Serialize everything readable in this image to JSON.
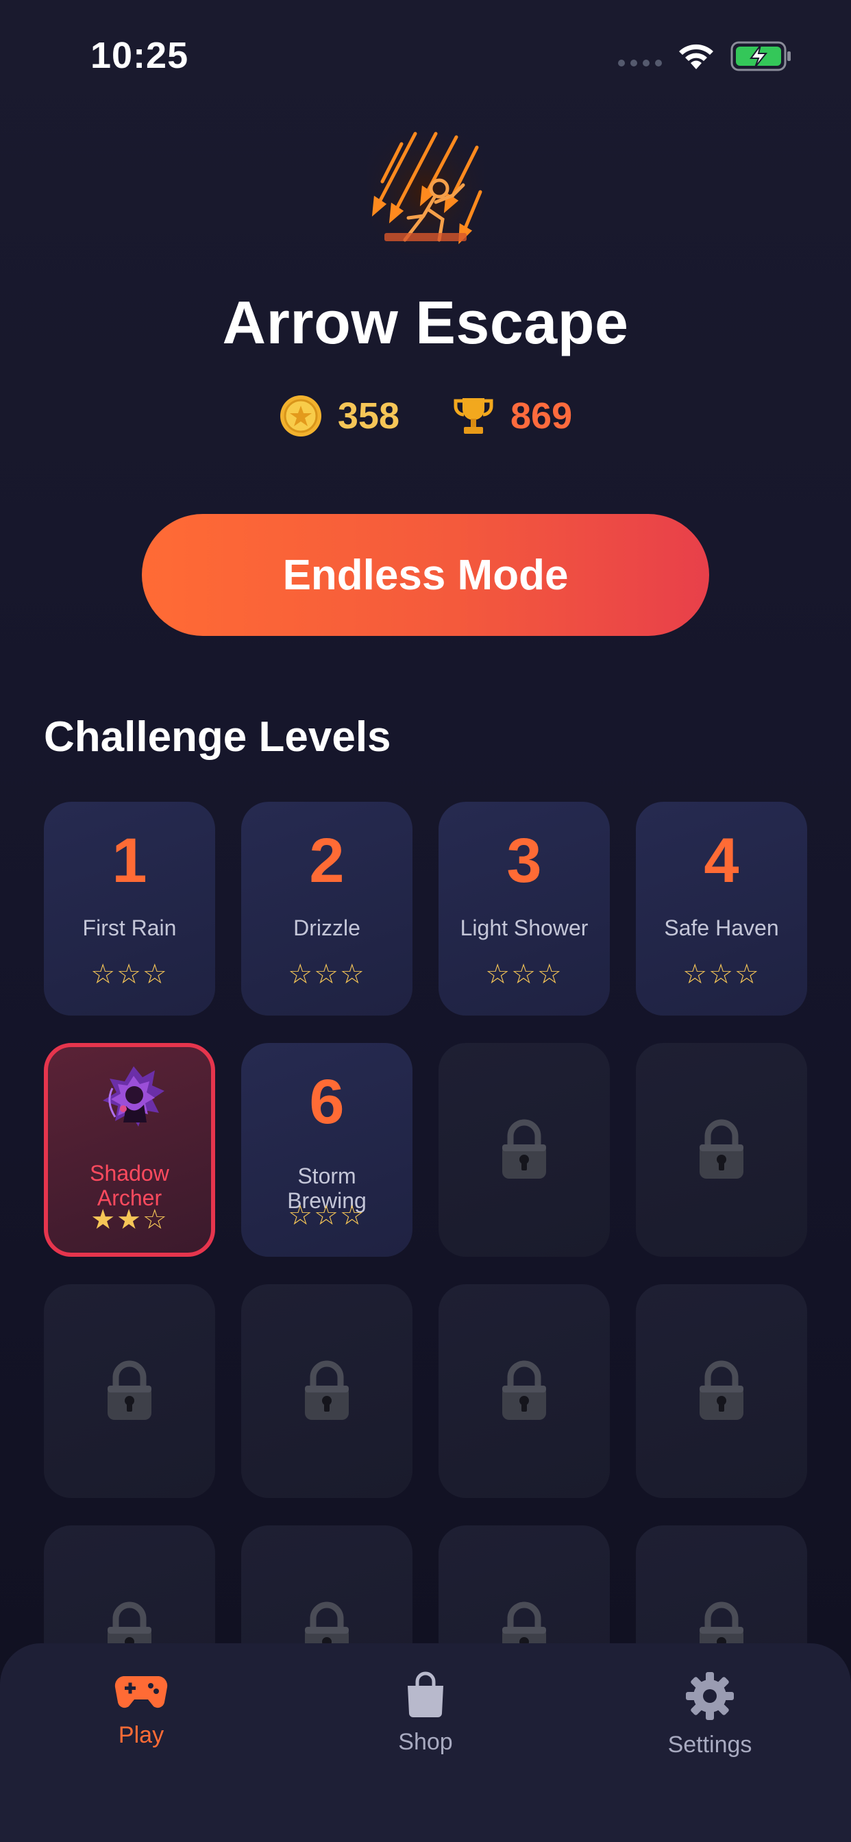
{
  "status_bar": {
    "time": "10:25"
  },
  "header": {
    "title": "Arrow Escape",
    "coins": "358",
    "trophies": "869"
  },
  "endless_button": {
    "label": "Endless Mode"
  },
  "section": {
    "title": "Challenge Levels"
  },
  "levels": [
    {
      "number": "1",
      "name": "First Rain",
      "stars": "☆☆☆",
      "earned": 0,
      "state": "unlocked"
    },
    {
      "number": "2",
      "name": "Drizzle",
      "stars": "☆☆☆",
      "earned": 0,
      "state": "unlocked"
    },
    {
      "number": "3",
      "name": "Light Shower",
      "stars": "☆☆☆",
      "earned": 0,
      "state": "unlocked"
    },
    {
      "number": "4",
      "name": "Safe Haven",
      "stars": "☆☆☆",
      "earned": 0,
      "state": "unlocked"
    },
    {
      "name_line1": "Shadow",
      "name_line2": "Archer",
      "stars": "★★☆",
      "earned": 2,
      "state": "boss",
      "icon": "shadow-archer-icon"
    },
    {
      "number": "6",
      "name_line1": "Storm",
      "name_line2": "Brewing",
      "stars": "☆☆☆",
      "earned": 0,
      "state": "unlocked"
    },
    {
      "state": "locked",
      "icon": "lock-icon"
    }
  ],
  "tabs": [
    {
      "label": "Play",
      "icon": "gamepad-icon",
      "active": true
    },
    {
      "label": "Shop",
      "icon": "shopping-bag-icon",
      "active": false
    },
    {
      "label": "Settings",
      "icon": "gear-icon",
      "active": false
    }
  ],
  "colors": {
    "accent": "#ff6b35",
    "gold": "#f6c657",
    "boss_border": "#e6354d",
    "background": "#1a1a2e"
  }
}
